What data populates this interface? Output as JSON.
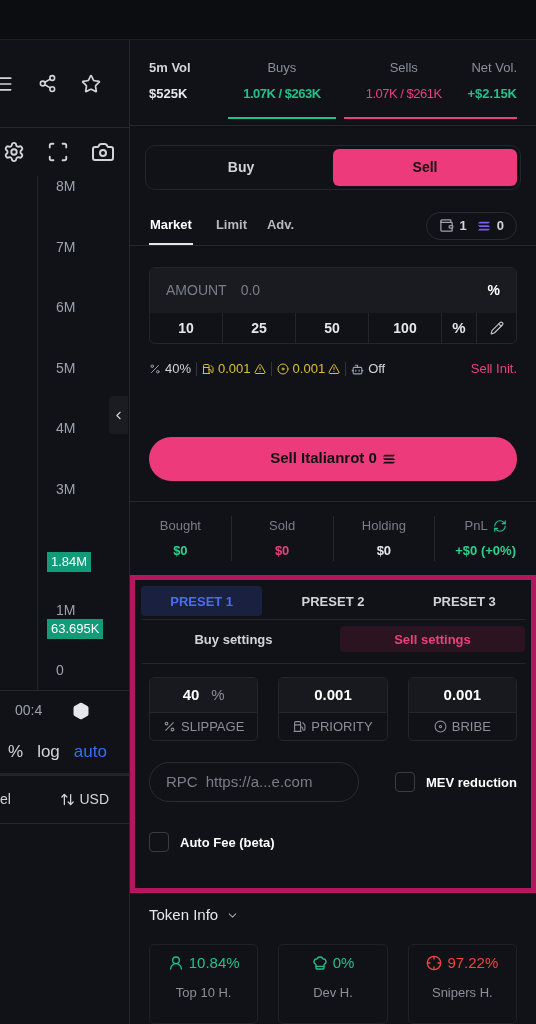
{
  "chart": {
    "y_labels": [
      "8M",
      "7M",
      "6M",
      "5M",
      "4M",
      "3M",
      "1M",
      "0"
    ],
    "price_tags": [
      {
        "text": "1.84M"
      },
      {
        "text": "63.695K"
      }
    ],
    "time_label": "00:4",
    "scale_options": [
      {
        "label": "%",
        "selected": false
      },
      {
        "label": "log",
        "selected": false
      },
      {
        "label": "auto",
        "selected": true
      }
    ],
    "footer_left": "el",
    "currency": "USD"
  },
  "volume": {
    "title": "5m Vol",
    "total": "$525K",
    "separator": "/",
    "buys": {
      "label": "Buys",
      "count": "1.07K",
      "value": "$263K"
    },
    "sells": {
      "label": "Sells",
      "count": "1.07K",
      "value": "$261K"
    },
    "net": {
      "label": "Net Vol.",
      "value": "+$2.15K"
    }
  },
  "side_toggle": [
    {
      "label": "Buy",
      "selected": false
    },
    {
      "label": "Sell",
      "selected": true
    }
  ],
  "order_tabs": [
    {
      "label": "Market",
      "selected": true
    },
    {
      "label": "Limit",
      "selected": false
    },
    {
      "label": "Adv.",
      "selected": false
    }
  ],
  "wallet": {
    "wallets": "1",
    "balance": "0"
  },
  "amount": {
    "label": "AMOUNT",
    "placeholder": "0.0",
    "unit": "%"
  },
  "quick_amounts": [
    "10",
    "25",
    "50",
    "100"
  ],
  "quick_unit": "%",
  "settings_summary": {
    "slippage": "40%",
    "priority": "0.001",
    "bribe": "0.001",
    "auto": "Off",
    "mode": "Sell Init."
  },
  "submit": {
    "label": "Sell Italianrot 0"
  },
  "position": [
    {
      "label": "Bought",
      "value": "$0",
      "color": "#2fd08f"
    },
    {
      "label": "Sold",
      "value": "$0",
      "color": "#e8417c"
    },
    {
      "label": "Holding",
      "value": "$0",
      "color": "#e5e7eb"
    },
    {
      "label": "PnL",
      "value": "+$0 (+0%)",
      "color": "#2fd08f"
    }
  ],
  "presets": [
    {
      "label": "PRESET 1",
      "selected": true
    },
    {
      "label": "PRESET 2",
      "selected": false
    },
    {
      "label": "PRESET 3",
      "selected": false
    }
  ],
  "settings_tabs": [
    {
      "label": "Buy settings",
      "selected": false
    },
    {
      "label": "Sell settings",
      "selected": true
    }
  ],
  "fields": [
    {
      "kind": "slippage",
      "value": "40",
      "unit": "%",
      "label": "SLIPPAGE"
    },
    {
      "kind": "priority",
      "value": "0.001",
      "label": "PRIORITY"
    },
    {
      "kind": "bribe",
      "value": "0.001",
      "label": "BRIBE"
    }
  ],
  "rpc": {
    "label": "RPC",
    "placeholder": "https://a...e.com"
  },
  "mev_reduction": {
    "label": "MEV reduction",
    "checked": false
  },
  "auto_fee": {
    "label": "Auto Fee (beta)",
    "checked": false
  },
  "token_info": {
    "title": "Token Info",
    "stats": [
      {
        "kind": "holders",
        "value": "10.84%",
        "label": "Top 10 H.",
        "color": "#22c08a"
      },
      {
        "kind": "dev",
        "value": "0%",
        "label": "Dev H.",
        "color": "#22c08a"
      },
      {
        "kind": "snipers",
        "value": "97.22%",
        "label": "Snipers H.",
        "color": "#ef4444"
      }
    ]
  }
}
